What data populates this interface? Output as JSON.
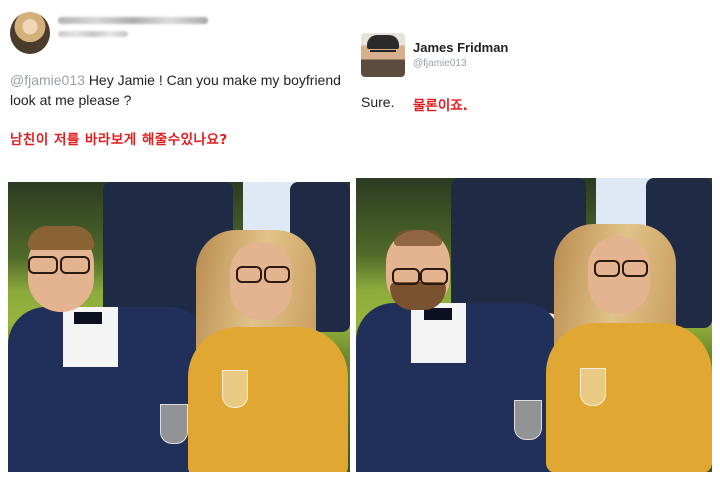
{
  "left_tweet": {
    "handle": "@fjamie013",
    "text": "Hey Jamie ! Can you make my boyfriend look at me please ?",
    "translation": "남친이 저를 바라보게 해줄수있나요?"
  },
  "right_tweet": {
    "name": "James Fridman",
    "handle": "@fjamie013",
    "reply": "Sure.",
    "translation": "물론이죠."
  },
  "colors": {
    "korean_text": "#e11d1d",
    "handle_text": "#9aa0a6"
  }
}
